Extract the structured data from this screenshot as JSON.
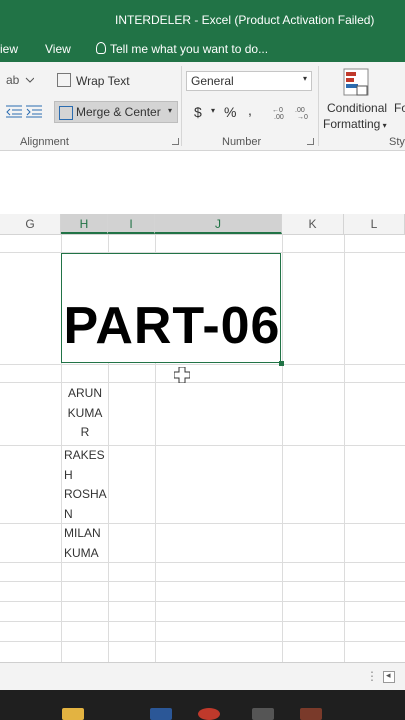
{
  "window": {
    "title": "INTERDELER - Excel (Product Activation Failed)"
  },
  "menu": {
    "view_partial": "iew",
    "view": "View",
    "tell_me": "Tell me what you want to do..."
  },
  "ribbon": {
    "wrap_text": "Wrap Text",
    "merge_center": "Merge & Center",
    "number_format": "General",
    "currency": "$",
    "percent": "%",
    "comma": ",",
    "conditional_formatting_line1": "Conditional",
    "conditional_formatting_line2": "Formatting",
    "format_partial": "Fo",
    "styles_partial": "Sty",
    "alignment_label": "Alignment",
    "number_label": "Number"
  },
  "columns": [
    "G",
    "H",
    "I",
    "J",
    "K",
    "L"
  ],
  "cells": {
    "merged_title": "PART-06",
    "name1": [
      "ARUN",
      "KUMA",
      "R"
    ],
    "name2": [
      "RAKES",
      "H"
    ],
    "name3": [
      "ROSHA",
      "N"
    ],
    "name4": [
      "MILAN",
      "KUMA"
    ]
  },
  "colors": {
    "excel_green": "#217346"
  }
}
